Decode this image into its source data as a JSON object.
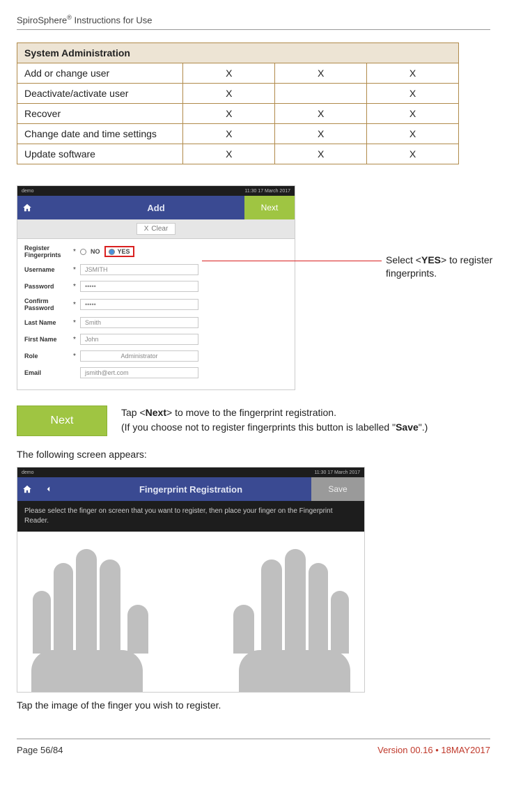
{
  "header": {
    "product": "SpiroSphere",
    "reg": "®",
    "suffix": "Instructions for Use"
  },
  "table": {
    "section_title": "System Administration",
    "rows": [
      {
        "label": "Add or change user",
        "c2": "X",
        "c3": "X",
        "c4": "X"
      },
      {
        "label": "Deactivate/activate user",
        "c2": "X",
        "c3": "",
        "c4": "X"
      },
      {
        "label": "Recover",
        "c2": "X",
        "c3": "X",
        "c4": "X"
      },
      {
        "label": "Change date and time settings",
        "c2": "X",
        "c3": "X",
        "c4": "X"
      },
      {
        "label": "Update software",
        "c2": "X",
        "c3": "X",
        "c4": "X"
      }
    ]
  },
  "screenshot1": {
    "status_left": "demo",
    "status_right": "11:30 17 March 2017",
    "title": "Add",
    "next_label": "Next",
    "clear_x": "X",
    "clear_label": "Clear",
    "fields": {
      "register_fp": {
        "label": "Register Fingerprints",
        "no": "NO",
        "yes": "YES"
      },
      "username": {
        "label": "Username",
        "value": "JSMITH"
      },
      "password": {
        "label": "Password",
        "value": "•••••"
      },
      "confirm": {
        "label": "Confirm Password",
        "value": "•••••"
      },
      "lastname": {
        "label": "Last Name",
        "value": "Smith"
      },
      "firstname": {
        "label": "First Name",
        "value": "John"
      },
      "role": {
        "label": "Role",
        "value": "Administrator"
      },
      "email": {
        "label": "Email",
        "value": "jsmith@ert.com"
      }
    }
  },
  "side_note": {
    "pre": "Select <",
    "bold": "YES",
    "post": "> to register fingerprints."
  },
  "next_instruction": {
    "button": "Next",
    "line1_pre": "Tap <",
    "line1_bold": "Next",
    "line1_post": "> to move to the fingerprint registration.",
    "line2_pre": "(If you choose not to register fingerprints this button is labelled \"",
    "line2_bold": "Save",
    "line2_post": "\".)"
  },
  "following_text": "The following screen appears:",
  "screenshot2": {
    "status_left": "demo",
    "status_right": "11:30 17 March 2017",
    "title": "Fingerprint Registration",
    "save_label": "Save",
    "instr": "Please select the finger on screen that you want to register, then place your finger on the Fingerprint Reader."
  },
  "tap_text": "Tap the image of the finger you wish to register.",
  "footer": {
    "page": "Page 56/84",
    "version": "Version 00.16 • 18MAY2017"
  }
}
